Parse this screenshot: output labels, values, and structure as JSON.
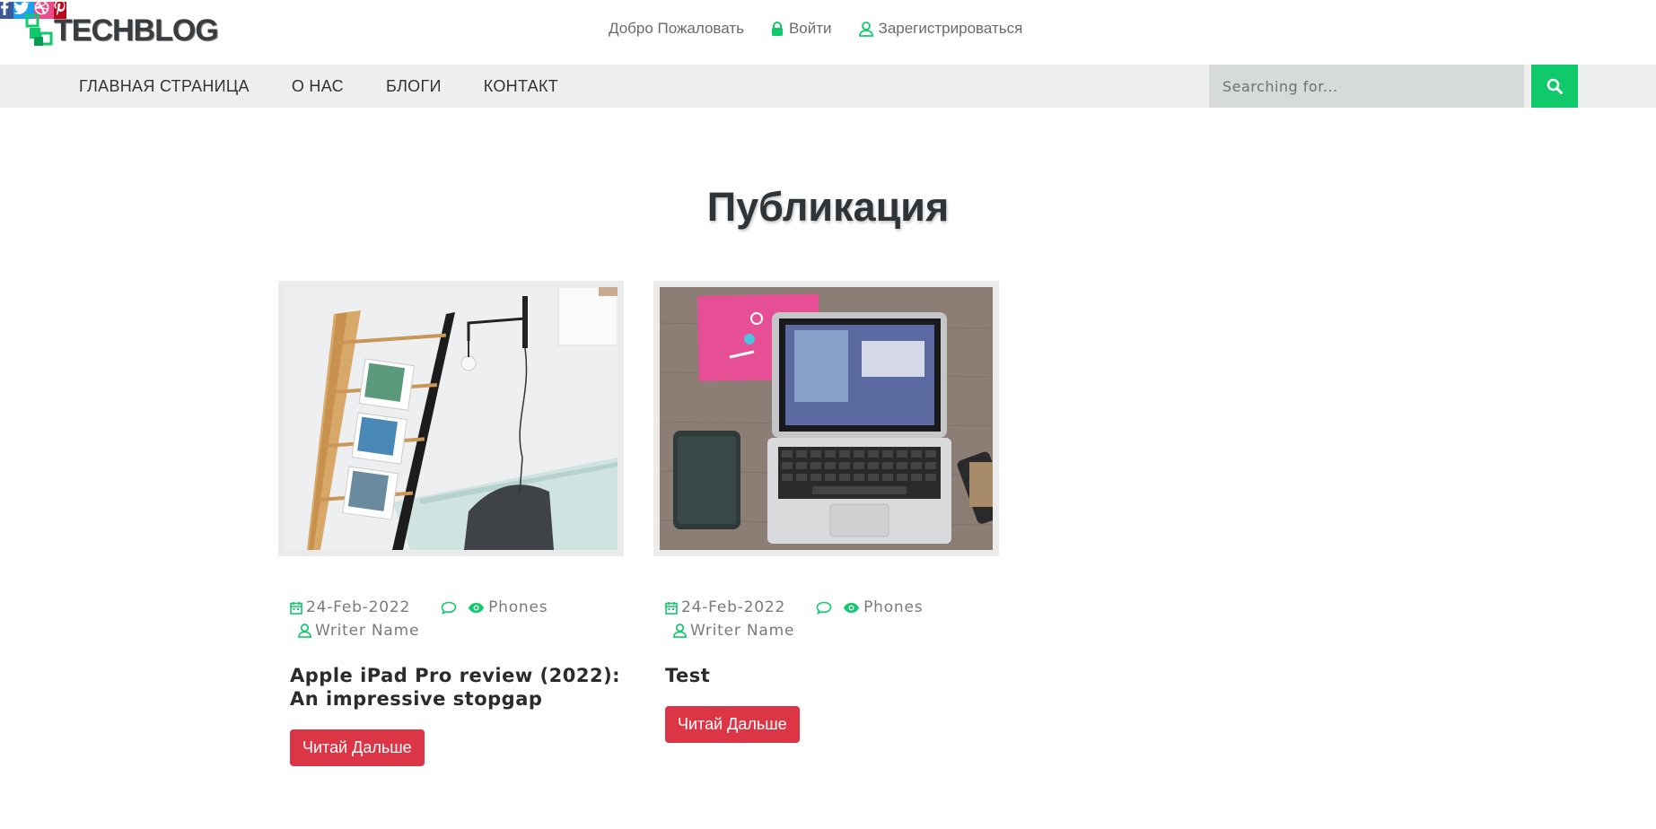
{
  "brand": {
    "name": "TECHBLOG"
  },
  "topnav": {
    "welcome": "Добро Пожаловать",
    "login": "Войти",
    "register": "Зарегистрироваться"
  },
  "social": [
    {
      "name": "facebook",
      "color": "#3b5998",
      "glyph": "f"
    },
    {
      "name": "twitter",
      "color": "#1da1f2"
    },
    {
      "name": "dribbble",
      "color": "#ea4c89"
    },
    {
      "name": "pinterest",
      "color": "#bd081c",
      "glyph": "P"
    }
  ],
  "menu": {
    "home": "ГЛАВНАЯ СТРАНИЦА",
    "about": "О НАС",
    "blogs": "БЛОГИ",
    "contact": "КОНТАКТ"
  },
  "search": {
    "placeholder": "Searching for..."
  },
  "page": {
    "title": "Публикация"
  },
  "posts": [
    {
      "date": "24-Feb-2022",
      "category": "Phones",
      "author": "Writer Name",
      "title": "Apple iPad Pro review (2022): An impressive stopgap",
      "button": "Читай Дальше"
    },
    {
      "date": "24-Feb-2022",
      "category": "Phones",
      "author": "Writer Name",
      "title": "Test",
      "button": "Читай Дальше"
    }
  ],
  "colors": {
    "accent": "#10c96b",
    "button": "#dc3545"
  }
}
